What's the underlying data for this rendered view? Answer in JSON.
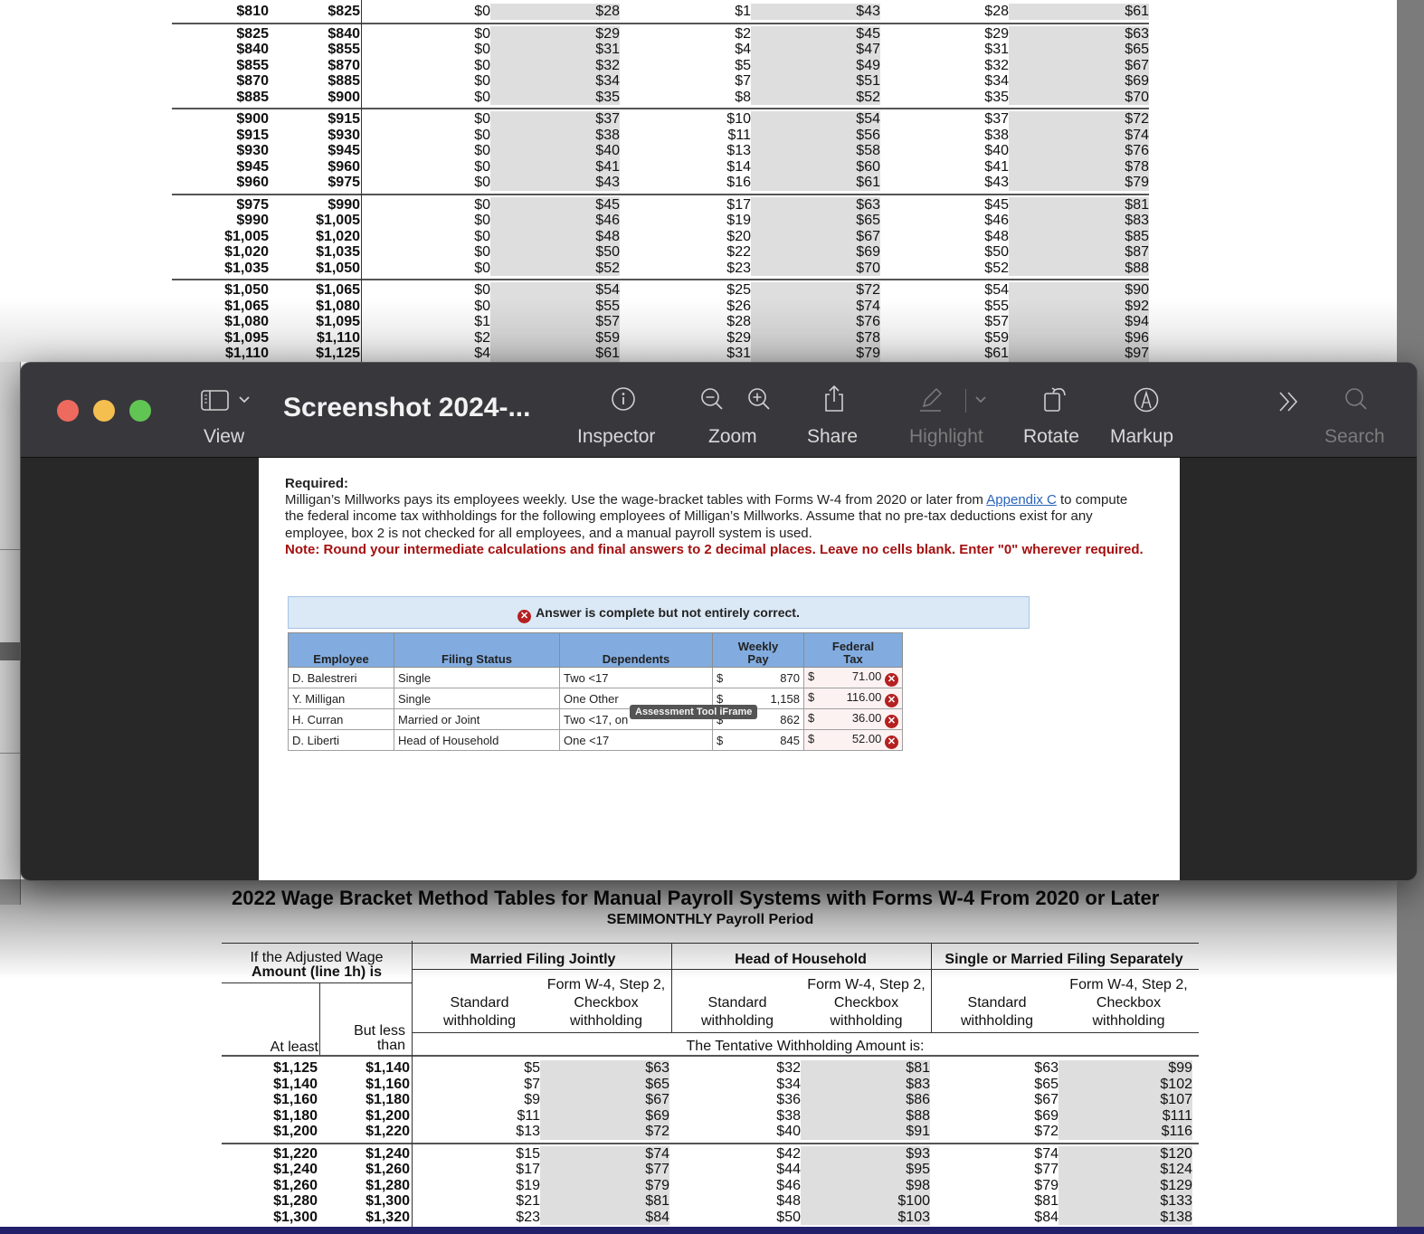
{
  "top_table": {
    "groups": [
      {
        "rows": [
          [
            "$810",
            "$825",
            "$0",
            "$28",
            "$1",
            "$43",
            "$28",
            "$61"
          ]
        ]
      },
      {
        "rows": [
          [
            "$825",
            "$840",
            "$0",
            "$29",
            "$2",
            "$45",
            "$29",
            "$63"
          ],
          [
            "$840",
            "$855",
            "$0",
            "$31",
            "$4",
            "$47",
            "$31",
            "$65"
          ],
          [
            "$855",
            "$870",
            "$0",
            "$32",
            "$5",
            "$49",
            "$32",
            "$67"
          ],
          [
            "$870",
            "$885",
            "$0",
            "$34",
            "$7",
            "$51",
            "$34",
            "$69"
          ],
          [
            "$885",
            "$900",
            "$0",
            "$35",
            "$8",
            "$52",
            "$35",
            "$70"
          ]
        ]
      },
      {
        "rows": [
          [
            "$900",
            "$915",
            "$0",
            "$37",
            "$10",
            "$54",
            "$37",
            "$72"
          ],
          [
            "$915",
            "$930",
            "$0",
            "$38",
            "$11",
            "$56",
            "$38",
            "$74"
          ],
          [
            "$930",
            "$945",
            "$0",
            "$40",
            "$13",
            "$58",
            "$40",
            "$76"
          ],
          [
            "$945",
            "$960",
            "$0",
            "$41",
            "$14",
            "$60",
            "$41",
            "$78"
          ],
          [
            "$960",
            "$975",
            "$0",
            "$43",
            "$16",
            "$61",
            "$43",
            "$79"
          ]
        ]
      },
      {
        "rows": [
          [
            "$975",
            "$990",
            "$0",
            "$45",
            "$17",
            "$63",
            "$45",
            "$81"
          ],
          [
            "$990",
            "$1,005",
            "$0",
            "$46",
            "$19",
            "$65",
            "$46",
            "$83"
          ],
          [
            "$1,005",
            "$1,020",
            "$0",
            "$48",
            "$20",
            "$67",
            "$48",
            "$85"
          ],
          [
            "$1,020",
            "$1,035",
            "$0",
            "$50",
            "$22",
            "$69",
            "$50",
            "$87"
          ],
          [
            "$1,035",
            "$1,050",
            "$0",
            "$52",
            "$23",
            "$70",
            "$52",
            "$88"
          ]
        ]
      },
      {
        "rows": [
          [
            "$1,050",
            "$1,065",
            "$0",
            "$54",
            "$25",
            "$72",
            "$54",
            "$90"
          ],
          [
            "$1,065",
            "$1,080",
            "$0",
            "$55",
            "$26",
            "$74",
            "$55",
            "$92"
          ],
          [
            "$1,080",
            "$1,095",
            "$1",
            "$57",
            "$28",
            "$76",
            "$57",
            "$94"
          ],
          [
            "$1,095",
            "$1,110",
            "$2",
            "$59",
            "$29",
            "$78",
            "$59",
            "$96"
          ],
          [
            "$1,110",
            "$1,125",
            "$4",
            "$61",
            "$31",
            "$79",
            "$61",
            "$97"
          ]
        ]
      }
    ]
  },
  "preview_window": {
    "title": "Screenshot 2024-...",
    "toolbar": {
      "view": "View",
      "inspector": "Inspector",
      "zoom": "Zoom",
      "share": "Share",
      "highlight": "Highlight",
      "rotate": "Rotate",
      "markup": "Markup",
      "search": "Search"
    },
    "traffic_light_colors": {
      "close": "#ee6a5e",
      "minimize": "#f5bf4f",
      "zoom": "#61c554"
    }
  },
  "question": {
    "required_label": "Required:",
    "text_before_link": "Milligan’s Millworks pays its employees weekly. Use the wage-bracket tables with Forms W-4 from 2020 or later from ",
    "link_text": "Appendix C",
    "text_after_link": " to compute the federal income tax withholdings for the following employees of Milligan’s Millworks. Assume that no pre-tax deductions exist for any employee, box 2 is not checked for all employees, and a manual payroll system is used.",
    "note": "Note: Round your intermediate calculations and final answers to 2 decimal places. Leave no cells blank. Enter \"0\" wherever required."
  },
  "result_banner": "Answer is complete but not entirely correct.",
  "answer_table": {
    "headers": {
      "employee": "Employee",
      "filing_status": "Filing Status",
      "dependents": "Dependents",
      "weekly_pay_1": "Weekly",
      "weekly_pay_2": "Pay",
      "federal_tax_1": "Federal",
      "federal_tax_2": "Tax"
    },
    "currency": "$",
    "rows": [
      {
        "employee": "D. Balestreri",
        "filing_status": "Single",
        "dependents": "Two <17",
        "weekly_pay": "870",
        "federal_tax": "71.00",
        "status": "incorrect"
      },
      {
        "employee": "Y. Milligan",
        "filing_status": "Single",
        "dependents": "One Other",
        "weekly_pay": "1,158",
        "federal_tax": "116.00",
        "status": "incorrect"
      },
      {
        "employee": "H. Curran",
        "filing_status": "Married or Joint",
        "dependents": "Two <17, on",
        "weekly_pay": "862",
        "federal_tax": "36.00",
        "status": "incorrect"
      },
      {
        "employee": "D. Liberti",
        "filing_status": "Head of Household",
        "dependents": "One <17",
        "weekly_pay": "845",
        "federal_tax": "52.00",
        "status": "incorrect"
      }
    ],
    "tooltip": "Assessment Tool iFrame"
  },
  "bottom_table": {
    "title": "2022 Wage Bracket Method Tables for Manual Payroll Systems with Forms W-4 From 2020 or Later",
    "subtitle": "SEMIMONTHLY Payroll Period",
    "wage_header_1": "If the Adjusted Wage",
    "wage_header_2": "Amount (line 1h) is",
    "at_least": "At least",
    "but_less_1": "But less",
    "but_less_2": "than",
    "mfj": "Married Filing Jointly",
    "hoh": "Head of Household",
    "single": "Single or Married Filing Separately",
    "standard_1": "Standard",
    "standard_2": "withholding",
    "checkbox_1": "Form W-4, Step 2,",
    "checkbox_2": "Checkbox",
    "checkbox_3": "withholding",
    "tentative": "The Tentative Withholding Amount is:",
    "groups": [
      {
        "rows": [
          [
            "$1,125",
            "$1,140",
            "$5",
            "$63",
            "$32",
            "$81",
            "$63",
            "$99"
          ],
          [
            "$1,140",
            "$1,160",
            "$7",
            "$65",
            "$34",
            "$83",
            "$65",
            "$102"
          ],
          [
            "$1,160",
            "$1,180",
            "$9",
            "$67",
            "$36",
            "$86",
            "$67",
            "$107"
          ],
          [
            "$1,180",
            "$1,200",
            "$11",
            "$69",
            "$38",
            "$88",
            "$69",
            "$111"
          ],
          [
            "$1,200",
            "$1,220",
            "$13",
            "$72",
            "$40",
            "$91",
            "$72",
            "$116"
          ]
        ]
      },
      {
        "rows": [
          [
            "$1,220",
            "$1,240",
            "$15",
            "$74",
            "$42",
            "$93",
            "$74",
            "$120"
          ],
          [
            "$1,240",
            "$1,260",
            "$17",
            "$77",
            "$44",
            "$95",
            "$77",
            "$124"
          ],
          [
            "$1,260",
            "$1,280",
            "$19",
            "$79",
            "$46",
            "$98",
            "$79",
            "$129"
          ],
          [
            "$1,280",
            "$1,300",
            "$21",
            "$81",
            "$48",
            "$100",
            "$81",
            "$133"
          ],
          [
            "$1,300",
            "$1,320",
            "$23",
            "$84",
            "$50",
            "$103",
            "$84",
            "$138"
          ]
        ]
      }
    ]
  }
}
